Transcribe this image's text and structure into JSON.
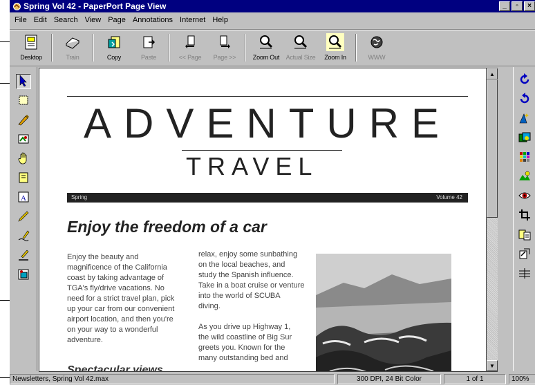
{
  "window": {
    "title": "Spring Vol 42 - PaperPort Page View",
    "controls": [
      "_",
      "▫",
      "×"
    ]
  },
  "menu": [
    "File",
    "Edit",
    "Search",
    "View",
    "Page",
    "Annotations",
    "Internet",
    "Help"
  ],
  "toolbar": [
    {
      "label": "Desktop",
      "icon": "desktop-icon",
      "enabled": true
    },
    {
      "label": "Train",
      "icon": "scanner-icon",
      "enabled": false
    },
    {
      "label": "Copy",
      "icon": "copy-icon",
      "enabled": true
    },
    {
      "label": "Paste",
      "icon": "paste-icon",
      "enabled": false
    },
    {
      "label": "<< Page",
      "icon": "previous-page-icon",
      "enabled": false
    },
    {
      "label": "Page >>",
      "icon": "next-page-icon",
      "enabled": false
    },
    {
      "label": "Zoom Out",
      "icon": "zoom-out-icon",
      "enabled": true
    },
    {
      "label": "Actual Size",
      "icon": "actual-size-icon",
      "enabled": false
    },
    {
      "label": "Zoom In",
      "icon": "zoom-in-icon",
      "enabled": true
    },
    {
      "label": "WWW",
      "icon": "globe-icon",
      "enabled": false
    }
  ],
  "left_tools": [
    "select-arrow-icon",
    "select-rectangle-icon",
    "highlighter-icon",
    "image-tool-icon",
    "grab-hand-icon",
    "note-icon",
    "text-tool-icon",
    "pen-icon",
    "freehand-line-icon",
    "straight-line-icon",
    "stamp-icon"
  ],
  "right_tools": [
    "rotate-clockwise-icon",
    "rotate-counterclockwise-icon",
    "sharpen-icon",
    "enhance-image-icon",
    "color-grid-icon",
    "brightness-icon",
    "red-eye-icon",
    "crop-icon",
    "copy-to-page-icon",
    "convert-icon",
    "straighten-icon"
  ],
  "document": {
    "masthead_title": "ADVENTURE",
    "masthead_subtitle": "TRAVEL",
    "band_left": "Spring",
    "band_right": "Volume 42",
    "headline": "Enjoy the freedom of a car",
    "column1": "Enjoy the beauty and\nmagnificence of the California\ncoast by taking advantage of\nTGA's fly/drive vacations. No\nneed for a strict travel plan, pick\nup your car from our convenient\nairport location, and then you're\non your way to a wonderful\nadventure.",
    "column2": "relax, enjoy some sunbathing\non the local beaches, and\nstudy the Spanish influence.\nTake in a boat cruise or venture\ninto the world of SCUBA\ndiving.\n\nAs you drive up Highway 1,\nthe wild coastline of Big Sur\ngreets you. Known for the\nmany outstanding bed and",
    "subhead": "Spectacular views"
  },
  "status": {
    "filename": "Newsletters, Spring Vol 42.max",
    "resolution": "300 DPI, 24 Bit Color",
    "page": "1 of 1",
    "zoom": "100%"
  },
  "colors": {
    "titlebar": "#000080",
    "chrome": "#c0c0c0",
    "band": "#222222"
  }
}
